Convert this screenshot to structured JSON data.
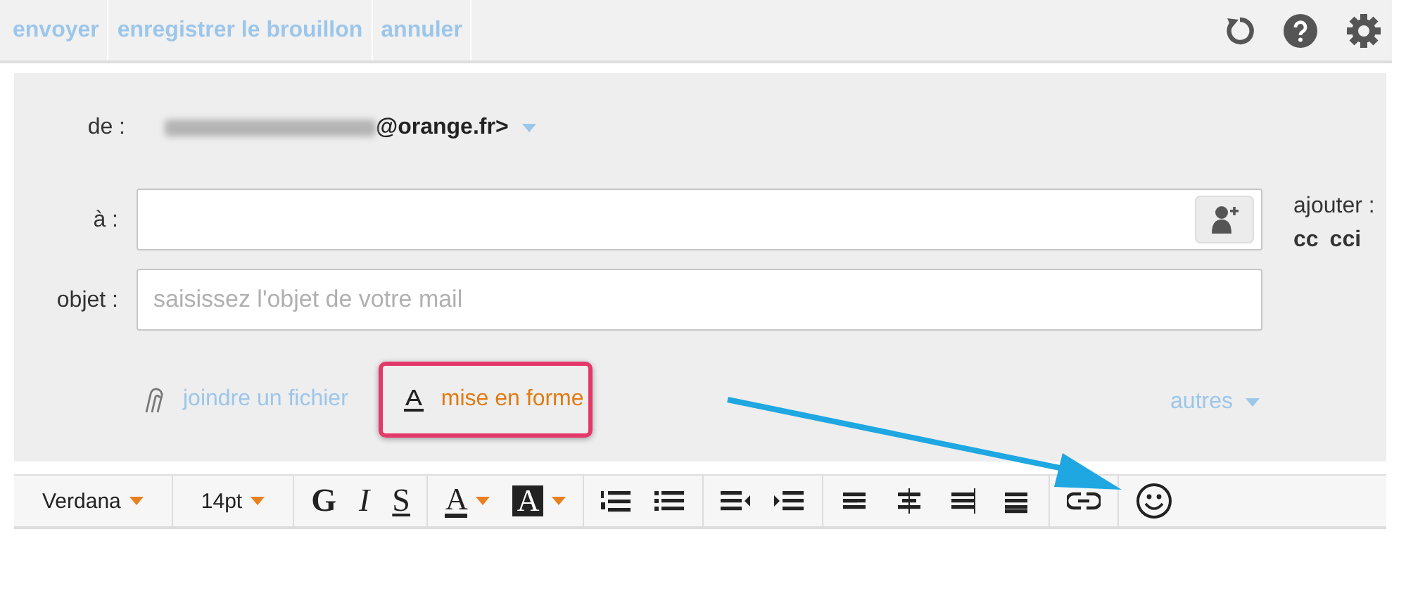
{
  "actions": [
    {
      "label": "envoyer"
    },
    {
      "label": "enregistrer le brouillon"
    },
    {
      "label": "annuler"
    }
  ],
  "header_icons": [
    {
      "kind": "refresh"
    },
    {
      "kind": "help"
    },
    {
      "kind": "settings"
    }
  ],
  "from": {
    "label": "de :",
    "address": "@orange.fr>"
  },
  "to": {
    "label": "à :"
  },
  "add": {
    "label": "ajouter :",
    "links": [
      "cc",
      "cci"
    ]
  },
  "subject": {
    "label": "objet :",
    "placeholder": "saisissez l'objet de votre mail"
  },
  "options": [
    {
      "kind": "attach",
      "label": "joindre un fichier",
      "highlighted": false
    },
    {
      "kind": "format",
      "label": "mise en forme",
      "highlighted": true
    }
  ],
  "more": {
    "label": "autres"
  },
  "toolbar": [
    {
      "items": [
        {
          "kind": "font",
          "label": "Verdana"
        }
      ]
    },
    {
      "items": [
        {
          "kind": "font",
          "label": "14pt"
        }
      ]
    },
    {
      "items": [
        {
          "kind": "bold",
          "label": "G"
        },
        {
          "kind": "italic",
          "label": "I"
        },
        {
          "kind": "underline",
          "label": "S"
        }
      ]
    },
    {
      "items": [
        {
          "kind": "text-color",
          "label": "A"
        },
        {
          "kind": "highlight",
          "label": "A"
        }
      ]
    },
    {
      "items": [
        {
          "kind": "ordered-list"
        },
        {
          "kind": "bullet-list"
        }
      ]
    },
    {
      "items": [
        {
          "kind": "outdent"
        },
        {
          "kind": "indent"
        }
      ]
    },
    {
      "items": [
        {
          "kind": "align-left"
        },
        {
          "kind": "align-center"
        },
        {
          "kind": "align-right"
        },
        {
          "kind": "justify"
        }
      ]
    },
    {
      "items": [
        {
          "kind": "link"
        }
      ]
    },
    {
      "items": [
        {
          "kind": "emoji"
        }
      ]
    }
  ]
}
